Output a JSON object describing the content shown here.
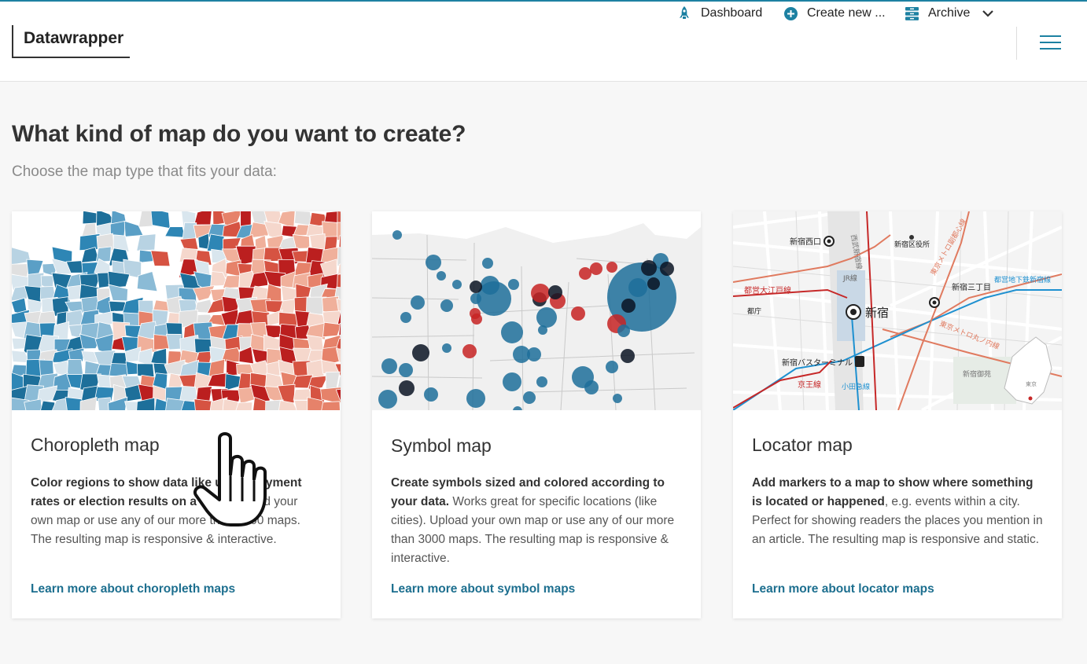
{
  "app": {
    "logo": "Datawrapper"
  },
  "nav": {
    "dashboard": "Dashboard",
    "create_new": "Create new ...",
    "archive": "Archive",
    "icons": [
      "rocket-icon",
      "plus-circle-icon",
      "archive-icon",
      "chevron-down-icon",
      "hamburger-menu-icon"
    ],
    "accent_color": "#1d81a2"
  },
  "page": {
    "title": "What kind of map do you want to create?",
    "subtitle": "Choose the map type that fits your data:"
  },
  "cards": [
    {
      "title": "Choropleth map",
      "desc_bold": "Color regions to show data like unemployment rates or election results on a map.",
      "desc_rest": " Upload your own map or use any of our more than 3000 maps. The resulting map is responsive & interactive.",
      "link": "Learn more about choropleth maps"
    },
    {
      "title": "Symbol map",
      "desc_bold": "Create symbols sized and colored according to your data.",
      "desc_rest": " Works great for specific locations (like cities). Upload your own map or use any of our more than 3000 maps. The resulting map is responsive & interactive.",
      "link": "Learn more about symbol maps"
    },
    {
      "title": "Locator map",
      "desc_bold": "Add markers to a map to show where something is located or happened",
      "desc_rest": ", e.g. events within a city. Perfect for showing readers the places you mention in an article. The resulting map is responsive and static.",
      "link": "Learn more about locator maps"
    }
  ],
  "locator_labels": {
    "nishiguchi": "新宿西口",
    "kuyakusho": "新宿区役所",
    "sanchome": "新宿三丁目",
    "oedo": "都営大江戸線",
    "toei_shinjuku": "都営地下鉄新宿線",
    "jr": "JR線",
    "tocho": "都庁",
    "shinjuku": "新宿",
    "bus_terminal": "新宿バスターミナル",
    "keio": "京王線",
    "odakyu": "小田急線",
    "marunouchi": "東京メトロ丸ノ内線",
    "fukutoshin": "東京メトロ副都心線",
    "gyoen": "新宿御苑",
    "seibu": "西武新宿線",
    "tokyo": "東京"
  }
}
